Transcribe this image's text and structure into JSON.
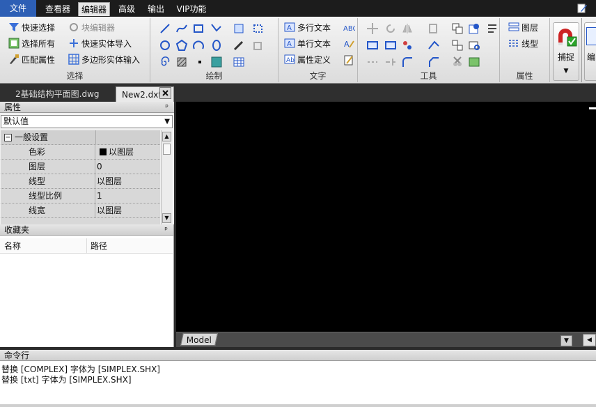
{
  "menubar": {
    "items": [
      "文件",
      "查看器",
      "编辑器",
      "高级",
      "输出",
      "VIP功能"
    ],
    "active": "编辑器"
  },
  "ribbon": {
    "select": {
      "label": "选择",
      "quick_select": "快速选择",
      "block_editor": "块编辑器",
      "select_all": "选择所有",
      "quick_entity_import": "快速实体导入",
      "match_properties": "匹配属性",
      "polygon_entity_input": "多边形实体输入"
    },
    "draw": {
      "label": "绘制"
    },
    "text": {
      "label": "文字",
      "mtext": "多行文本",
      "single_text": "单行文本",
      "attr_def": "属性定义"
    },
    "tools": {
      "label": "工具"
    },
    "properties": {
      "label": "属性",
      "layer": "图层",
      "linetype": "线型"
    },
    "snap": {
      "label": "捕捉"
    },
    "edit_partial": "编"
  },
  "tabs": {
    "tab1": "2基础结构平面图.dwg",
    "tab2": "New2.dxf"
  },
  "properties_panel": {
    "title": "属性",
    "selector": "默认值",
    "section": "一般设置",
    "rows": [
      {
        "name": "色彩",
        "value": "以图层"
      },
      {
        "name": "图层",
        "value": "0"
      },
      {
        "name": "线型",
        "value": "以图层"
      },
      {
        "name": "线型比例",
        "value": "1"
      },
      {
        "name": "线宽",
        "value": "以图层"
      }
    ]
  },
  "favorites_panel": {
    "title": "收藏夹",
    "col_name": "名称",
    "col_path": "路径"
  },
  "layout": {
    "model_tab": "Model"
  },
  "command": {
    "title": "命令行",
    "lines": [
      "替换 [COMPLEX] 字体为 [SIMPLEX.SHX]",
      "替换 [txt] 字体为 [SIMPLEX.SHX]"
    ]
  },
  "colors": {
    "menubar_bg": "#1c1c1c",
    "file_menu_bg": "#2d5fb5",
    "canvas_bg": "#000000",
    "snap_magnet": "#cc2222",
    "snap_check": "#2aa52a"
  }
}
